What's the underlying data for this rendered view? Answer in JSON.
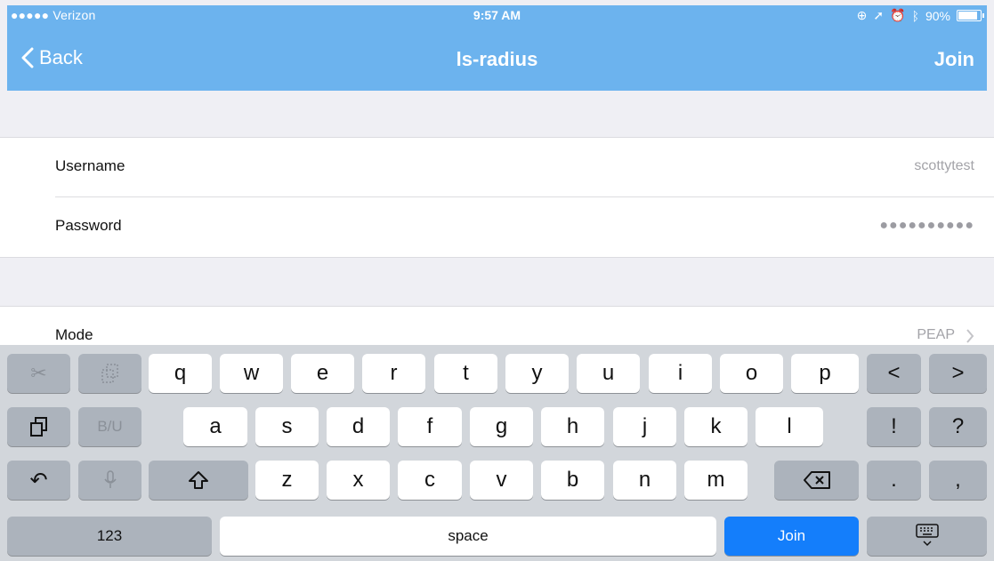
{
  "status_bar": {
    "carrier": "●●●●● Verizon",
    "time": "9:57 AM",
    "battery": "90%"
  },
  "nav": {
    "back_label": "Back",
    "title": "ls-radius",
    "join_label": "Join"
  },
  "form": {
    "username": {
      "label": "Username",
      "value": "scottytest"
    },
    "password": {
      "label": "Password",
      "value": "●●●●●●●●●●"
    },
    "mode": {
      "label": "Mode",
      "value": "PEAP"
    }
  },
  "keyboard": {
    "row1": [
      "q",
      "w",
      "e",
      "r",
      "t",
      "y",
      "u",
      "i",
      "o",
      "p"
    ],
    "row2": [
      "a",
      "s",
      "d",
      "f",
      "g",
      "h",
      "j",
      "k",
      "l"
    ],
    "row3": [
      "z",
      "x",
      "c",
      "v",
      "b",
      "n",
      "m"
    ],
    "nav_left": "<",
    "nav_right": ">",
    "exclaim": "!",
    "question": "?",
    "period": ".",
    "comma": ",",
    "biu": "B/U",
    "numbers": "123",
    "space": "space",
    "join": "Join"
  }
}
